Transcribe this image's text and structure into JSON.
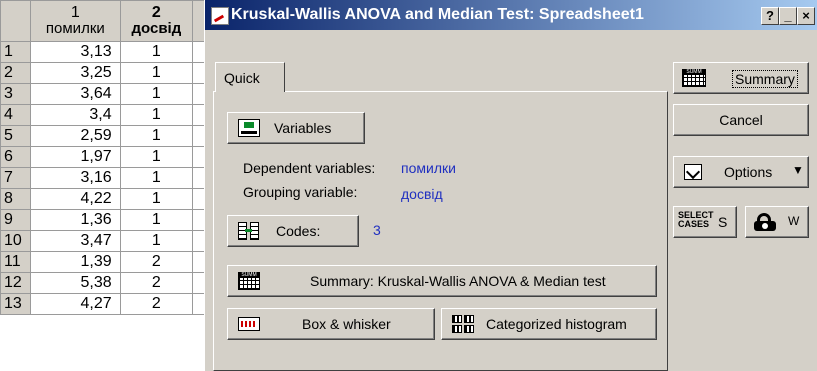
{
  "sheet": {
    "columns": [
      {
        "num": "1",
        "name": "помилки"
      },
      {
        "num": "2",
        "name": "досвід"
      }
    ],
    "rows": [
      {
        "n": "1",
        "v": "3,13",
        "g": "1"
      },
      {
        "n": "2",
        "v": "3,25",
        "g": "1"
      },
      {
        "n": "3",
        "v": "3,64",
        "g": "1"
      },
      {
        "n": "4",
        "v": "3,4",
        "g": "1"
      },
      {
        "n": "5",
        "v": "2,59",
        "g": "1"
      },
      {
        "n": "6",
        "v": "1,97",
        "g": "1"
      },
      {
        "n": "7",
        "v": "3,16",
        "g": "1"
      },
      {
        "n": "8",
        "v": "4,22",
        "g": "1"
      },
      {
        "n": "9",
        "v": "1,36",
        "g": "1"
      },
      {
        "n": "10",
        "v": "3,47",
        "g": "1"
      },
      {
        "n": "11",
        "v": "1,39",
        "g": "2"
      },
      {
        "n": "12",
        "v": "5,38",
        "g": "2"
      },
      {
        "n": "13",
        "v": "4,27",
        "g": "2"
      }
    ]
  },
  "dialog": {
    "title": "Kruskal-Wallis ANOVA and Median Test: Spreadsheet1",
    "help": "?",
    "minimize": "_",
    "close": "×",
    "tab": "Quick",
    "variables_label": "Variables",
    "dependent_label": "Dependent variables:",
    "dependent_value": "помилки",
    "grouping_label": "Grouping variable:",
    "grouping_value": "досвід",
    "codes_label": "Codes:",
    "codes_value": "3",
    "summary_kw_label": "Summary:  Kruskal-Wallis ANOVA  & Median test",
    "box_label": "Box & whisker",
    "hist_label": "Categorized histogram",
    "summary_btn": "Summary",
    "cancel_btn": "Cancel",
    "options_btn": "Options",
    "select_cases": "SELECT CASES",
    "s_label": "S",
    "w_label": "W"
  }
}
